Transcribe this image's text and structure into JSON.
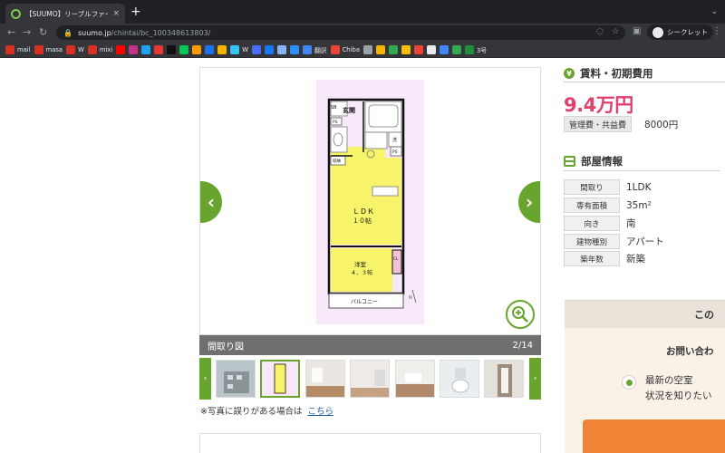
{
  "browser": {
    "tab_title": "【SUUMO】リーブルファイン上",
    "tab_close": "×",
    "new_tab": "+",
    "tab_menu": "⌄",
    "url_host": "suumo.jp",
    "url_path": "/chintai/bc_100348613803/",
    "profile_label": "シークレット"
  },
  "bookmarks": [
    {
      "label": "mail",
      "color": "#d93025"
    },
    {
      "label": "masa",
      "color": "#d93025"
    },
    {
      "label": "W",
      "color": "#d93025"
    },
    {
      "label": "mixi",
      "color": "#d93025"
    },
    {
      "label": "",
      "color": "#ff0000"
    },
    {
      "label": "",
      "color": "#c13584"
    },
    {
      "label": "",
      "color": "#1da1f2"
    },
    {
      "label": "",
      "color": "#e53935"
    },
    {
      "label": "",
      "color": "#111111"
    },
    {
      "label": "",
      "color": "#06c755"
    },
    {
      "label": "",
      "color": "#ff9900"
    },
    {
      "label": "",
      "color": "#1a73e8"
    },
    {
      "label": "",
      "color": "#f5b400"
    },
    {
      "label": "W",
      "color": "#36c5f0"
    },
    {
      "label": "",
      "color": "#4a6cf7"
    },
    {
      "label": "",
      "color": "#1877f2"
    },
    {
      "label": "",
      "color": "#8ab4f8"
    },
    {
      "label": "",
      "color": "#2d8cff"
    },
    {
      "label": "翻訳",
      "color": "#4285f4"
    },
    {
      "label": "Chiba",
      "color": "#ea4335"
    },
    {
      "label": "",
      "color": "#9aa0a6"
    },
    {
      "label": "",
      "color": "#f4b400"
    },
    {
      "label": "",
      "color": "#34a853"
    },
    {
      "label": "",
      "color": "#fbbc04"
    },
    {
      "label": "",
      "color": "#ea4335"
    },
    {
      "label": "",
      "color": "#e8eaed"
    },
    {
      "label": "",
      "color": "#4285f4"
    },
    {
      "label": "",
      "color": "#34a853"
    },
    {
      "label": "3号",
      "color": "#1e8e3e"
    }
  ],
  "gallery": {
    "caption": "間取り図",
    "counter": "2/14",
    "note_text": "※写真に誤りがある場合は",
    "note_link": "こちら"
  },
  "floorplan": {
    "entrance": "玄関",
    "sb": "SB",
    "ps1": "PS",
    "ps2": "PS",
    "wash": "洗",
    "storage": "収納",
    "ldk": "ＬＤＫ",
    "ldk_size": "１０帖",
    "western": "洋室",
    "western_size": "４．３帖",
    "cl": "CL",
    "balcony": "バルコニー"
  },
  "rent": {
    "heading": "賃料・初期費用",
    "yen_icon": "¥",
    "value": "9.4万円",
    "fee_label": "管理費・共益費",
    "fee_value": "8000円"
  },
  "room": {
    "heading": "部屋情報",
    "specs": [
      {
        "label": "間取り",
        "value": "1LDK"
      },
      {
        "label": "専有面積",
        "value": "35m²"
      },
      {
        "label": "向き",
        "value": "南"
      },
      {
        "label": "建物種別",
        "value": "アパート"
      },
      {
        "label": "築年数",
        "value": "新築"
      }
    ]
  },
  "inquiry": {
    "top_text": "この",
    "title": "お問い合わ",
    "option_line1": "最新の空室",
    "option_line2": "状況を知りたい"
  },
  "colors": {
    "accent_green": "#68a52e",
    "price_pink": "#e2416e",
    "button_orange": "#f08434"
  }
}
